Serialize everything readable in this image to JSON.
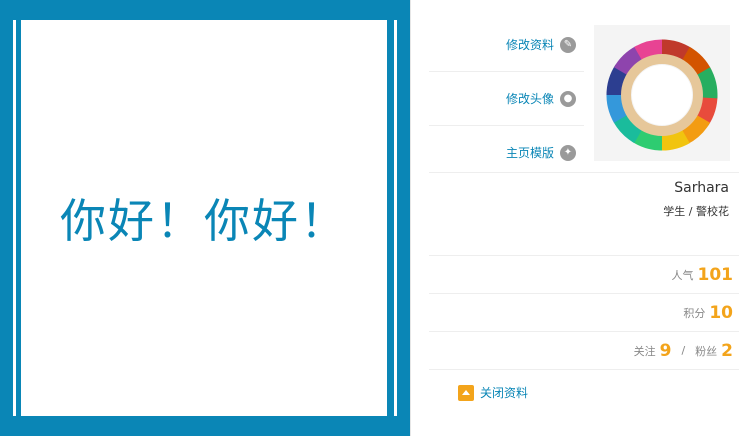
{
  "banner": {
    "greeting": "你好！你好！"
  },
  "profile": {
    "actions": [
      {
        "label": "修改资料",
        "icon": "edit-icon"
      },
      {
        "label": "修改头像",
        "icon": "user-icon"
      },
      {
        "label": "主页模版",
        "icon": "pin-icon"
      }
    ],
    "name": "Sarhara",
    "role": "学生 / 警校花",
    "stats": {
      "popularity_value": "101",
      "popularity_label": "人气",
      "points_value": "10",
      "points_label": "积分",
      "fans_value": "2",
      "fans_label": "粉丝",
      "following_value": "9",
      "following_label": "关注"
    },
    "close_label": "关闭资料"
  },
  "colors": {
    "accent_blue": "#0a86b6",
    "accent_orange": "#f3a41b"
  }
}
